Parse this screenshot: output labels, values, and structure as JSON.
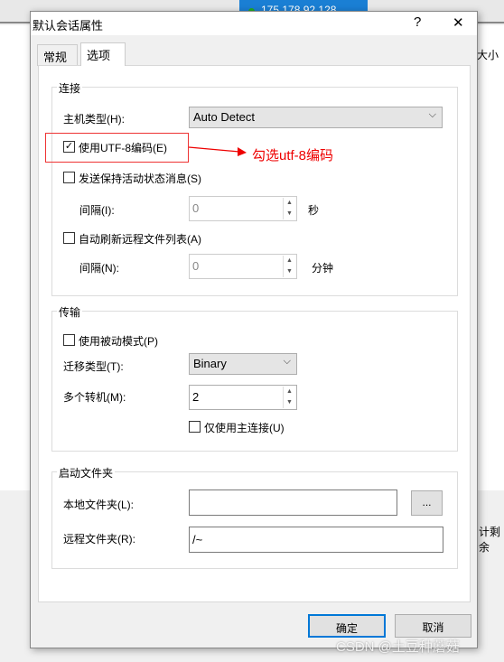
{
  "background": {
    "tab_label": "175.178.92.128",
    "col_fragment_1": "大小",
    "col_fragment_2": "计剩余"
  },
  "dialog": {
    "title": "默认会话属性",
    "help": "?",
    "close": "✕",
    "tabs": [
      {
        "label": "常规",
        "active": false
      },
      {
        "label": "选项",
        "active": true
      }
    ],
    "connection": {
      "group": "连接",
      "host_type_label": "主机类型(H):",
      "host_type_value": "Auto Detect",
      "utf8_label": "使用UTF-8编码(E)",
      "utf8_checked": true,
      "keepalive_label": "发送保持活动状态消息(S)",
      "keepalive_checked": false,
      "interval1_label": "间隔(I):",
      "interval1_value": "0",
      "interval1_unit": "秒",
      "autorefresh_label": "自动刷新远程文件列表(A)",
      "autorefresh_checked": false,
      "interval2_label": "间隔(N):",
      "interval2_value": "0",
      "interval2_unit": "分钟"
    },
    "transfer": {
      "group": "传输",
      "passive_label": "使用被动模式(P)",
      "passive_checked": false,
      "type_label": "迁移类型(T):",
      "type_value": "Binary",
      "multi_label": "多个转机(M):",
      "multi_value": "2",
      "main_only_label": "仅使用主连接(U)",
      "main_only_checked": false
    },
    "startup": {
      "group": "启动文件夹",
      "local_label": "本地文件夹(L):",
      "local_value": "",
      "browse": "...",
      "remote_label": "远程文件夹(R):",
      "remote_value": "/~"
    },
    "ok": "确定",
    "cancel": "取消"
  },
  "annotation": {
    "text": "勾选utf-8编码",
    "color": "#e00000"
  },
  "watermark": "CSDN @土豆种蘑菇"
}
